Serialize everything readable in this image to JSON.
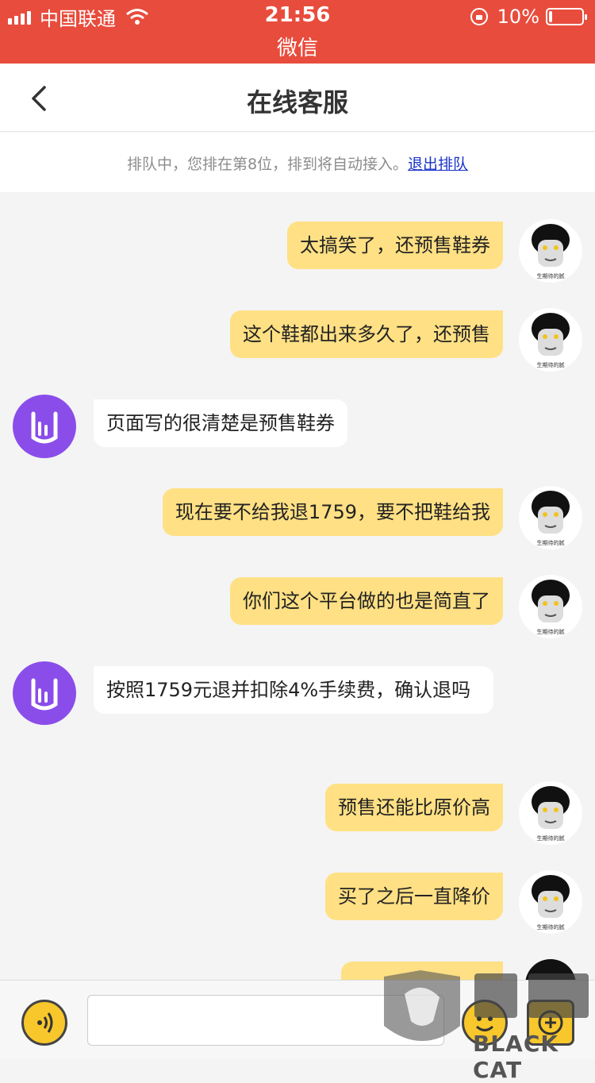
{
  "status_bar": {
    "carrier": "中国联通",
    "time": "21:56",
    "app_name": "微信",
    "battery": "10%",
    "battery_level": 0.1
  },
  "header": {
    "title": "在线客服"
  },
  "queue": {
    "text": "排队中，您排在第8位，排到将自动接入。",
    "exit_link": "退出排队"
  },
  "messages": [
    {
      "from": "me",
      "text": "太搞笑了，还预售鞋券"
    },
    {
      "from": "me",
      "text": "这个鞋都出来多久了，还预售"
    },
    {
      "from": "cs",
      "text": "页面写的很清楚是预售鞋券"
    },
    {
      "from": "me",
      "text": "现在要不给我退1759，要不把鞋给我"
    },
    {
      "from": "me",
      "text": "你们这个平台做的也是简直了"
    },
    {
      "from": "cs",
      "text": "按照1759元退并扣除4%手续费，确认退吗"
    },
    {
      "from": "me",
      "text": "预售还能比原价高"
    },
    {
      "from": "me",
      "text": "买了之后一直降价"
    }
  ],
  "avatar_me": {
    "caption": "生期待的腻"
  },
  "watermark": {
    "text": "BLACK CAT"
  },
  "colors": {
    "status_bar": "#e84c3d",
    "my_bubble": "#ffe084",
    "cs_bubble": "#ffffff",
    "cs_avatar": "#8a4dea",
    "link": "#1a33cc",
    "input_buttons": "#f7c72b"
  },
  "icons": [
    "signal-icon",
    "wifi-icon",
    "rotation-lock-icon",
    "battery-icon",
    "back-icon",
    "voice-icon",
    "emoji-icon",
    "plus-icon",
    "rock-hand-icon"
  ]
}
